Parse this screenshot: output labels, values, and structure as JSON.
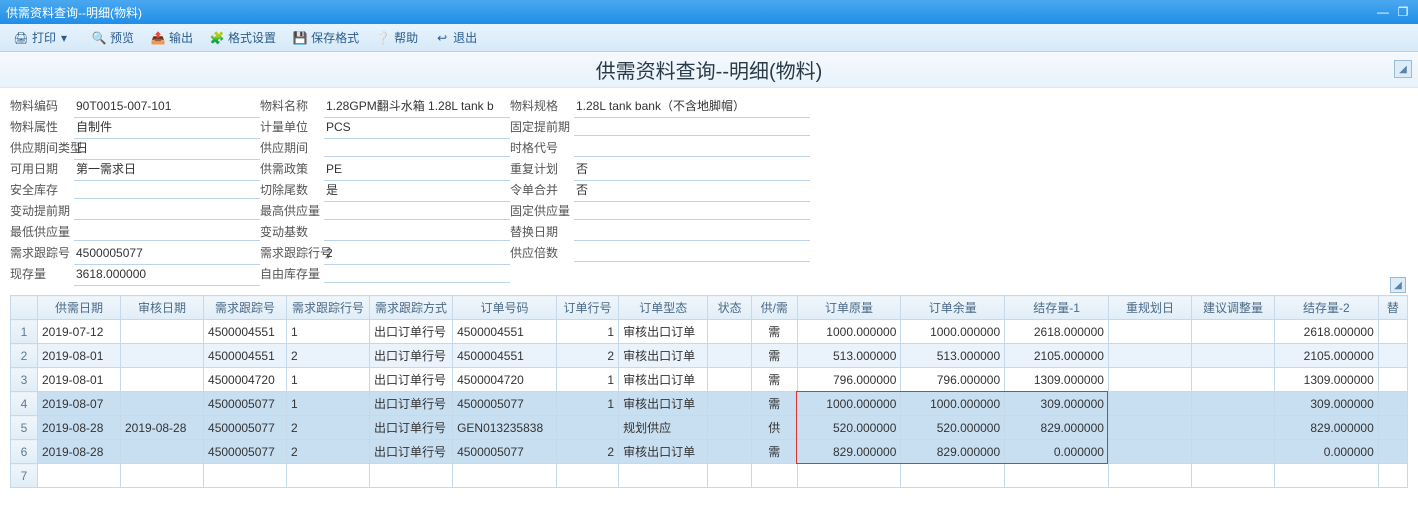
{
  "window": {
    "title": "供需资料查询--明细(物料)",
    "minimize": "—",
    "restore": "❐"
  },
  "toolbar": {
    "print": "打印",
    "preview": "预览",
    "export": "输出",
    "format": "格式设置",
    "save_format": "保存格式",
    "help": "帮助",
    "exit": "退出"
  },
  "header": {
    "title": "供需资料查询--明细(物料)"
  },
  "form": {
    "col1": {
      "material_code_l": "物料编码",
      "material_code_v": "90T0015-007-101",
      "material_attr_l": "物料属性",
      "material_attr_v": "自制件",
      "supply_period_type_l": "供应期间类型",
      "supply_period_type_v": "日",
      "avail_date_l": "可用日期",
      "avail_date_v": "第一需求日",
      "safety_stock_l": "安全库存",
      "safety_stock_v": "",
      "var_lead_l": "变动提前期",
      "var_lead_v": "",
      "min_supply_l": "最低供应量",
      "min_supply_v": "",
      "demand_trace_l": "需求跟踪号",
      "demand_trace_v": "4500005077",
      "inventory_l": "现存量",
      "inventory_v": "3618.000000"
    },
    "col2": {
      "material_name_l": "物料名称",
      "material_name_v": "1.28GPM翻斗水箱 1.28L tank b",
      "unit_l": "计量单位",
      "unit_v": "PCS",
      "supply_period_l": "供应期间",
      "supply_period_v": "",
      "policy_l": "供需政策",
      "policy_v": "PE",
      "cut_tail_l": "切除尾数",
      "cut_tail_v": "是",
      "max_supply_l": "最高供应量",
      "max_supply_v": "",
      "var_base_l": "变动基数",
      "var_base_v": "",
      "trace_line_l": "需求跟踪行号",
      "trace_line_v": "2",
      "free_stock_l": "自由库存量",
      "free_stock_v": ""
    },
    "col3": {
      "spec_l": "物料规格",
      "spec_v": "1.28L tank bank（不含地脚帽）",
      "fixed_lead_l": "固定提前期",
      "fixed_lead_v": "",
      "time_code_l": "时格代号",
      "time_code_v": "",
      "replan_l": "重复计划",
      "replan_v": "否",
      "merge_order_l": "令单合并",
      "merge_order_v": "否",
      "fixed_supply_l": "固定供应量",
      "fixed_supply_v": "",
      "replace_date_l": "替换日期",
      "replace_date_v": "",
      "supply_mult_l": "供应倍数",
      "supply_mult_v": ""
    }
  },
  "grid": {
    "cols": [
      "",
      "供需日期",
      "审核日期",
      "需求跟踪号",
      "需求跟踪行号",
      "需求跟踪方式",
      "订单号码",
      "订单行号",
      "订单型态",
      "状态",
      "供/需",
      "订单原量",
      "订单余量",
      "结存量-1",
      "重规划日",
      "建议调整量",
      "结存量-2",
      "替"
    ],
    "rows": [
      {
        "n": 1,
        "date": "2019-07-12",
        "audit": "",
        "trace": "4500004551",
        "line": "1",
        "method": "出口订单行号",
        "order": "4500004551",
        "oline": "1",
        "otype": "审核出口订单",
        "status": "",
        "sd": "需",
        "orig": "1000.000000",
        "rem": "1000.000000",
        "bal1": "2618.000000",
        "replan": "",
        "adj": "",
        "bal2": "2618.000000"
      },
      {
        "n": 2,
        "date": "2019-08-01",
        "audit": "",
        "trace": "4500004551",
        "line": "2",
        "method": "出口订单行号",
        "order": "4500004551",
        "oline": "2",
        "otype": "审核出口订单",
        "status": "",
        "sd": "需",
        "orig": "513.000000",
        "rem": "513.000000",
        "bal1": "2105.000000",
        "replan": "",
        "adj": "",
        "bal2": "2105.000000"
      },
      {
        "n": 3,
        "date": "2019-08-01",
        "audit": "",
        "trace": "4500004720",
        "line": "1",
        "method": "出口订单行号",
        "order": "4500004720",
        "oline": "1",
        "otype": "审核出口订单",
        "status": "",
        "sd": "需",
        "orig": "796.000000",
        "rem": "796.000000",
        "bal1": "1309.000000",
        "replan": "",
        "adj": "",
        "bal2": "1309.000000"
      },
      {
        "n": 4,
        "date": "2019-08-07",
        "audit": "",
        "trace": "4500005077",
        "line": "1",
        "method": "出口订单行号",
        "order": "4500005077",
        "oline": "1",
        "otype": "审核出口订单",
        "status": "",
        "sd": "需",
        "orig": "1000.000000",
        "rem": "1000.000000",
        "bal1": "309.000000",
        "replan": "",
        "adj": "",
        "bal2": "309.000000",
        "sel": true
      },
      {
        "n": 5,
        "date": "2019-08-28",
        "audit": "2019-08-28",
        "trace": "4500005077",
        "line": "2",
        "method": "出口订单行号",
        "order": "GEN013235838",
        "oline": "",
        "otype": "规划供应",
        "status": "",
        "sd": "供",
        "orig": "520.000000",
        "rem": "520.000000",
        "bal1": "829.000000",
        "replan": "",
        "adj": "",
        "bal2": "829.000000",
        "sel": true
      },
      {
        "n": 6,
        "date": "2019-08-28",
        "audit": "",
        "trace": "4500005077",
        "line": "2",
        "method": "出口订单行号",
        "order": "4500005077",
        "oline": "2",
        "otype": "审核出口订单",
        "status": "",
        "sd": "需",
        "orig": "829.000000",
        "rem": "829.000000",
        "bal1": "0.000000",
        "replan": "",
        "adj": "",
        "bal2": "0.000000",
        "sel": true
      },
      {
        "n": 7,
        "date": "",
        "audit": "",
        "trace": "",
        "line": "",
        "method": "",
        "order": "",
        "oline": "",
        "otype": "",
        "status": "",
        "sd": "",
        "orig": "",
        "rem": "",
        "bal1": "",
        "replan": "",
        "adj": "",
        "bal2": ""
      }
    ]
  }
}
